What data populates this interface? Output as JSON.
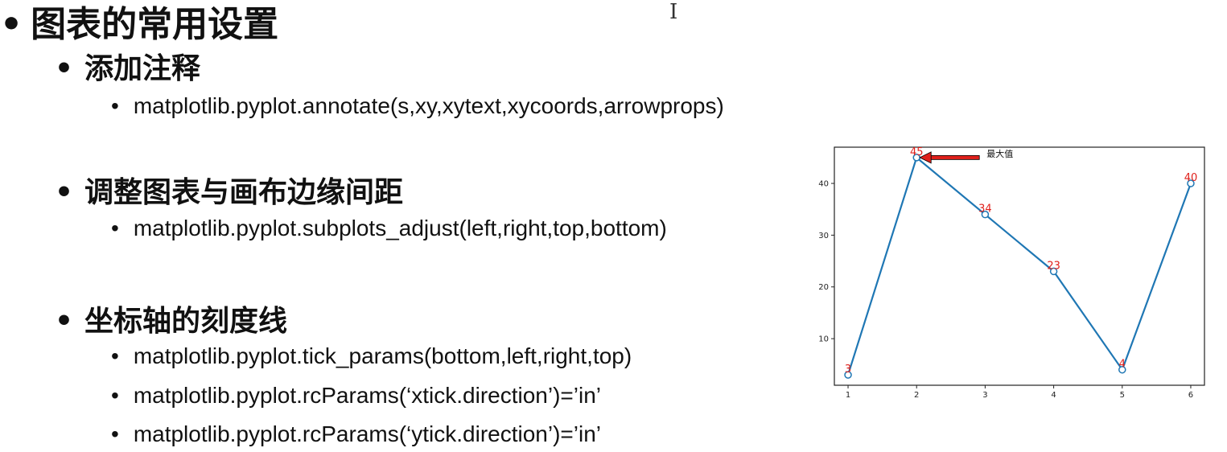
{
  "heading": "图表的常用设置",
  "cursor_glyph": "I",
  "sections": [
    {
      "title": "添加注释",
      "items": [
        "matplotlib.pyplot.annotate(s,xy,xytext,xycoords,arrowprops)"
      ]
    },
    {
      "title": "调整图表与画布边缘间距",
      "items": [
        "matplotlib.pyplot.subplots_adjust(left,right,top,bottom)"
      ]
    },
    {
      "title": "坐标轴的刻度线",
      "items": [
        "matplotlib.pyplot.tick_params(bottom,left,right,top)",
        "matplotlib.pyplot.rcParams(‘xtick.direction’)=’in’",
        "matplotlib.pyplot.rcParams(‘ytick.direction’)=’in’"
      ]
    }
  ],
  "chart_data": {
    "type": "line",
    "x": [
      1,
      2,
      3,
      4,
      5,
      6
    ],
    "series": [
      {
        "values": [
          3,
          45,
          34,
          23,
          4,
          40
        ]
      }
    ],
    "xticks": [
      1,
      2,
      3,
      4,
      5,
      6
    ],
    "yticks": [
      10,
      20,
      30,
      40
    ],
    "xlim": [
      0.8,
      6.2
    ],
    "ylim": [
      1,
      47
    ],
    "annotation": {
      "text": "最大值",
      "x": 2,
      "y": 45
    },
    "data_labels": true,
    "line_color": "#1f77b4",
    "label_color": "#e0201b",
    "arrow_color": "#e0201b",
    "grid": false
  }
}
